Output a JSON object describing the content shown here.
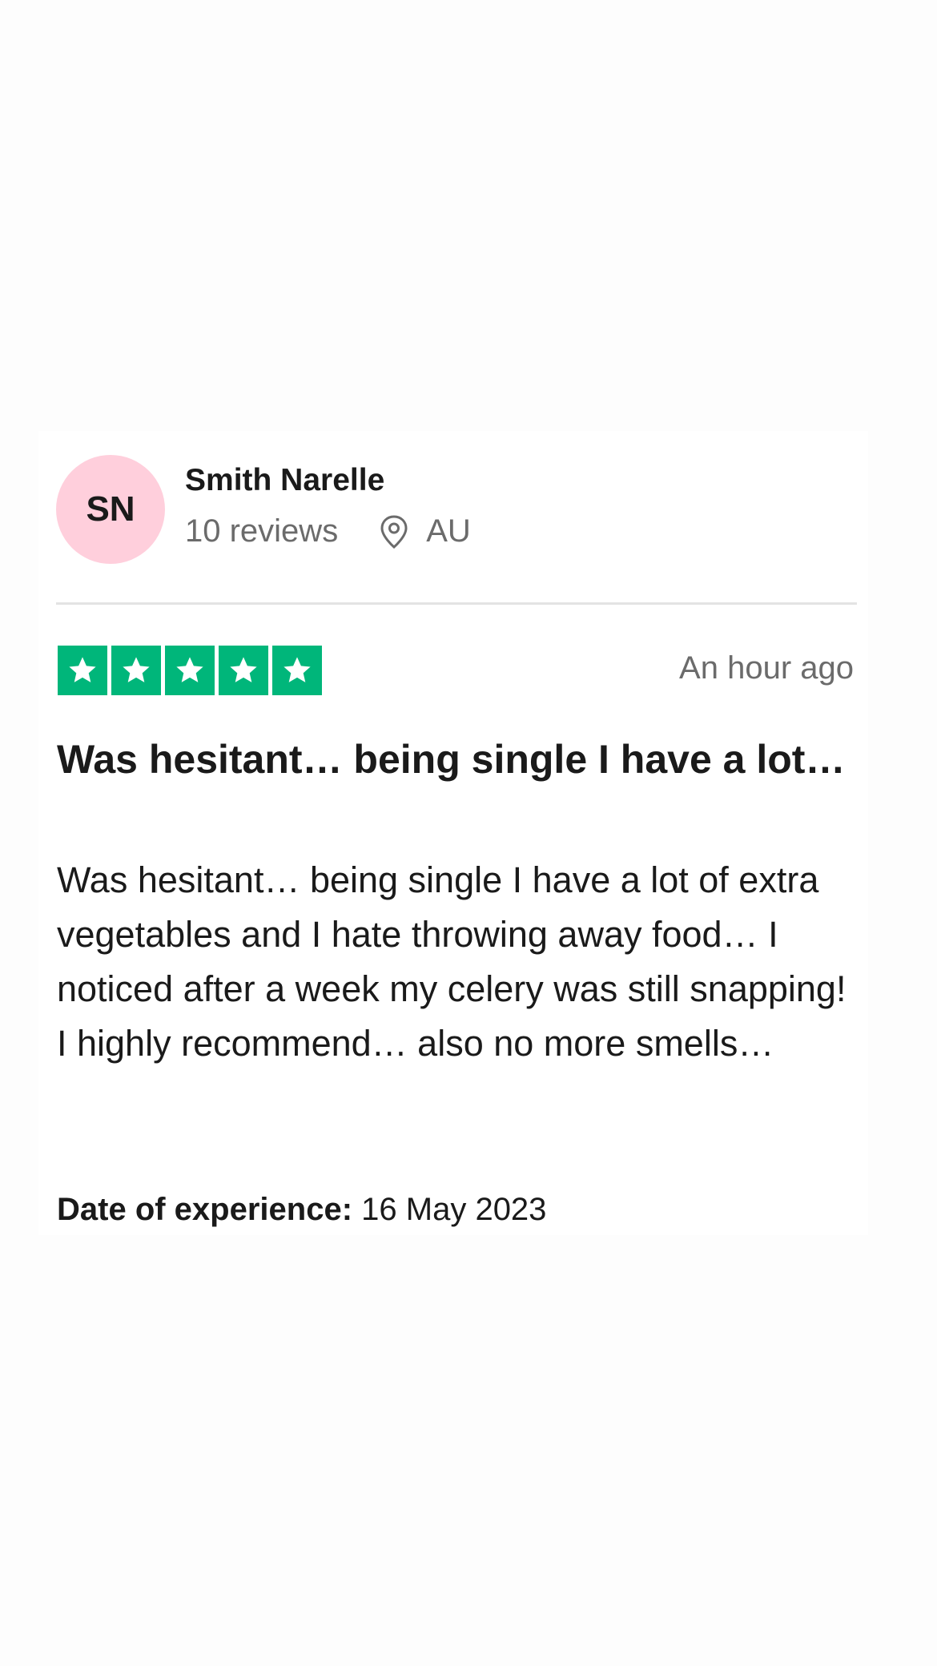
{
  "review": {
    "avatar_initials": "SN",
    "avatar_color": "#ffcfdc",
    "reviewer_name": "Smith Narelle",
    "review_count": "10 reviews",
    "location_icon": "location-pin-icon",
    "country": "AU",
    "rating": 5,
    "rating_max": 5,
    "star_color": "#00b67a",
    "time_ago": "An hour ago",
    "title": "Was hesitant… being single I have a lot…",
    "body": "Was hesitant… being single I have a lot of extra vegetables and I hate throwing away food… I noticed after a week my celery was still snapping!\nI highly recommend… also no more smells…",
    "date_label": "Date of experience:",
    "date_value": "16 May 2023"
  }
}
